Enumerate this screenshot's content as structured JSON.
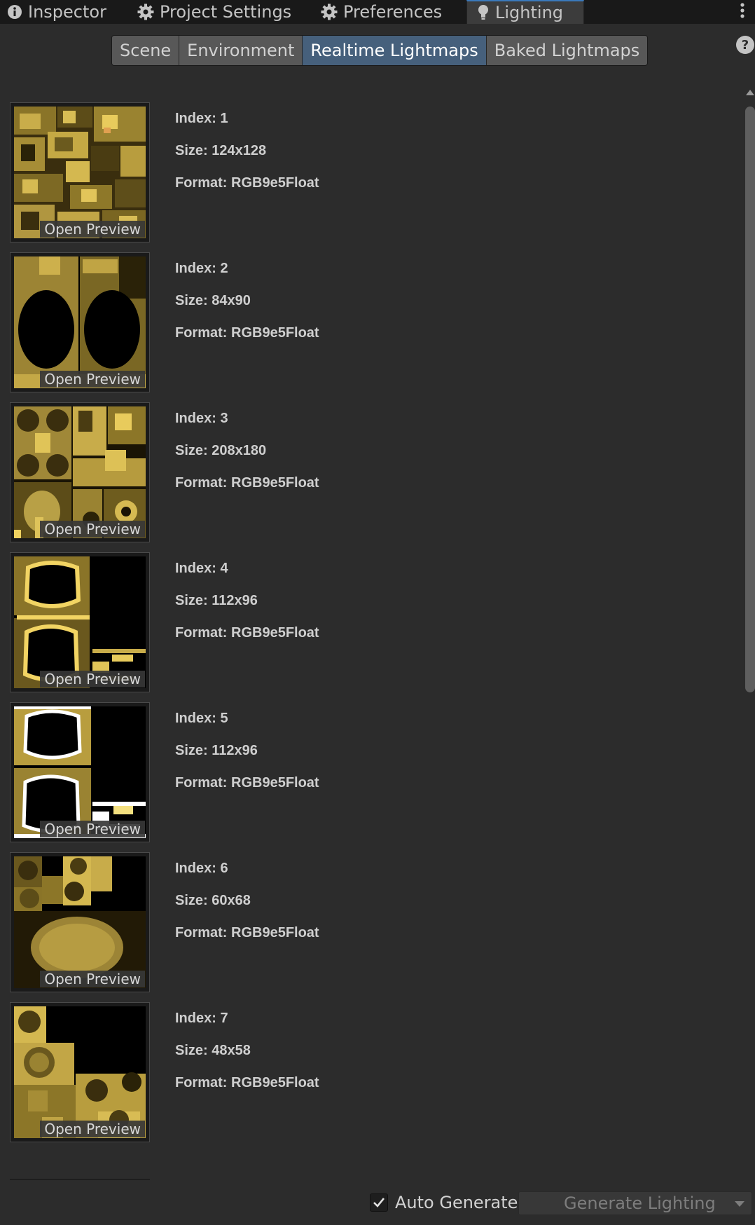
{
  "window_tabs": [
    {
      "label": "Inspector",
      "icon": "info-icon"
    },
    {
      "label": "Project Settings",
      "icon": "gear-icon"
    },
    {
      "label": "Preferences",
      "icon": "gear-icon"
    },
    {
      "label": "Lighting",
      "icon": "lightbulb-icon",
      "active": true
    }
  ],
  "segments": [
    {
      "label": "Scene"
    },
    {
      "label": "Environment"
    },
    {
      "label": "Realtime Lightmaps",
      "active": true
    },
    {
      "label": "Baked Lightmaps"
    }
  ],
  "open_preview_label": "Open Preview",
  "lightmaps": [
    {
      "index": "Index: 1",
      "size": "Size: 124x128",
      "format": "Format: RGB9e5Float"
    },
    {
      "index": "Index: 2",
      "size": "Size: 84x90",
      "format": "Format: RGB9e5Float"
    },
    {
      "index": "Index: 3",
      "size": "Size: 208x180",
      "format": "Format: RGB9e5Float"
    },
    {
      "index": "Index: 4",
      "size": "Size: 112x96",
      "format": "Format: RGB9e5Float"
    },
    {
      "index": "Index: 5",
      "size": "Size: 112x96",
      "format": "Format: RGB9e5Float"
    },
    {
      "index": "Index: 6",
      "size": "Size: 60x68",
      "format": "Format: RGB9e5Float"
    },
    {
      "index": "Index: 7",
      "size": "Size: 48x58",
      "format": "Format: RGB9e5Float"
    }
  ],
  "footer": {
    "auto_generate_label": "Auto Generate",
    "auto_generate_checked": true,
    "generate_label": "Generate Lighting"
  },
  "colors": {
    "accent": "#3a79bb",
    "active_segment": "#46607c",
    "lightmap_gold": "#c8ac4a",
    "background": "#2c2c2c"
  }
}
